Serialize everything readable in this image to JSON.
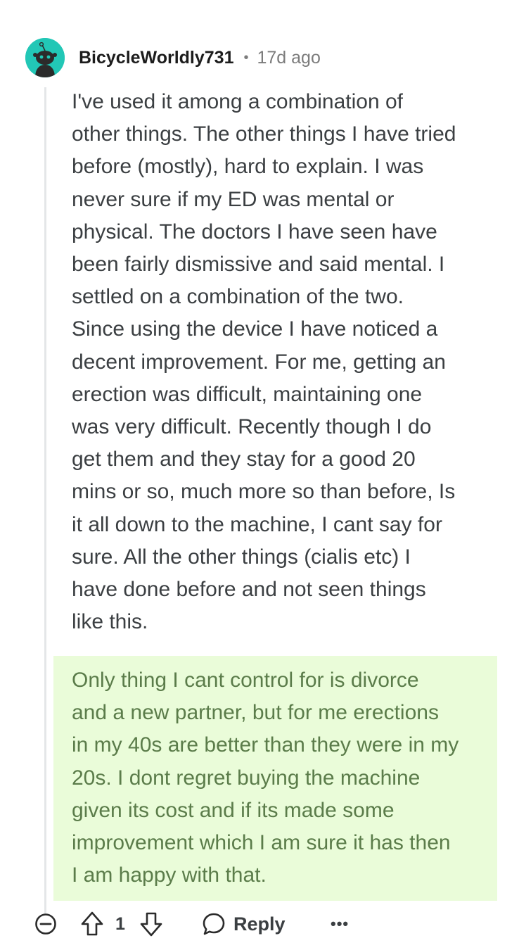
{
  "comment": {
    "username": "BicycleWorldly731",
    "separator": "•",
    "timestamp": "17d ago",
    "body": "I've used it among a combination of\nother things. The other things I have tried\nbefore (mostly), hard to explain. I was\nnever sure if my ED was mental or\nphysical. The doctors I have seen have\nbeen fairly dismissive and said mental. I\nsettled on a combination of the two.\nSince using the device I have noticed a\ndecent improvement. For me, getting an\nerection was difficult, maintaining one\nwas very difficult. Recently though I do\nget them and they stay for a good 20\nmins or so, much more so than before, Is\nit all down to the machine, I cant say for\nsure. All the other things (cialis etc) I\nhave done before and not seen things\nlike this.",
    "highlight": "Only thing I cant control for is divorce\nand a new partner, but for me erections\nin my 40s are better than they were in my\n20s. I dont regret buying the machine\ngiven its cost and if its made some\nimprovement which I am sure it has then\nI am happy with that."
  },
  "actions": {
    "vote_count": "1",
    "reply_label": "Reply",
    "more_label": "•••"
  },
  "icons": {
    "avatar": "snoo-avatar-icon",
    "collapse": "collapse-icon",
    "upvote": "upvote-icon",
    "downvote": "downvote-icon",
    "reply": "reply-icon",
    "more": "more-icon"
  },
  "colors": {
    "avatar_bg": "#22c7b6",
    "highlight_bg": "#eafcd9",
    "highlight_text": "#5b7c4a",
    "body_text": "#3b3f42",
    "meta_text": "#7c7c7c"
  }
}
